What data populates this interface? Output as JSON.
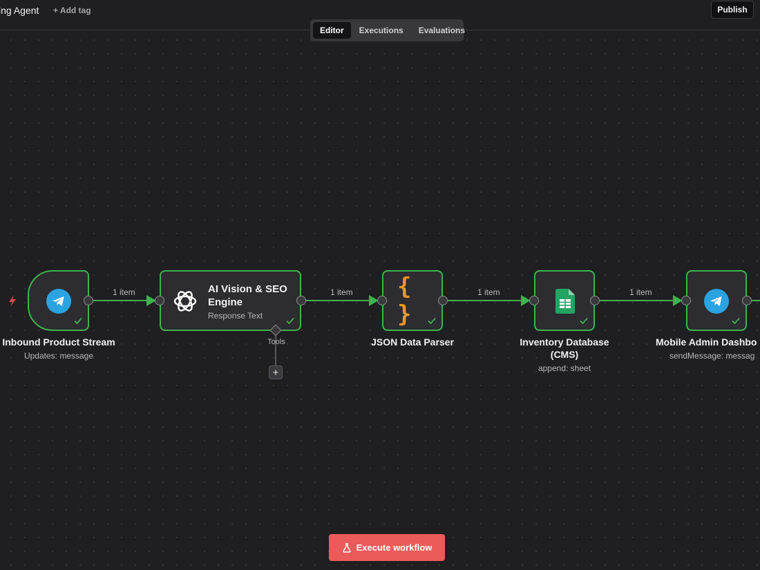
{
  "header": {
    "workflow_name": "ing Agent",
    "add_tag": "+ Add tag",
    "publish_label": "Publish"
  },
  "tabs": [
    {
      "label": "Editor",
      "active": true
    },
    {
      "label": "Executions",
      "active": false
    },
    {
      "label": "Evaluations",
      "active": false
    }
  ],
  "nodes": [
    {
      "title": "Inbound Product Stream",
      "subtitle": "Updates: message",
      "icon": "telegram-icon",
      "status": "success"
    },
    {
      "title": "AI Vision & SEO Engine",
      "subtitle": "Response Text",
      "icon": "openai-icon",
      "status": "success",
      "sub_port_label": "Tools"
    },
    {
      "title": "JSON Data Parser",
      "subtitle": "",
      "icon": "braces-icon",
      "status": "success"
    },
    {
      "title": "Inventory Database (CMS)",
      "subtitle": "append: sheet",
      "icon": "google-sheets-icon",
      "status": "success"
    },
    {
      "title": "Mobile Admin Dashbo",
      "subtitle": "sendMessage: messag",
      "icon": "telegram-icon",
      "status": "success"
    }
  ],
  "edges": [
    {
      "label": "1 item"
    },
    {
      "label": "1 item"
    },
    {
      "label": "1 item"
    },
    {
      "label": "1 item"
    }
  ],
  "execute_label": "Execute workflow",
  "colors": {
    "success": "#3fb24f",
    "execute": "#eb5b59",
    "telegram": "#2aa3e0",
    "braces": "#f0962a",
    "sheets": "#21a464"
  }
}
